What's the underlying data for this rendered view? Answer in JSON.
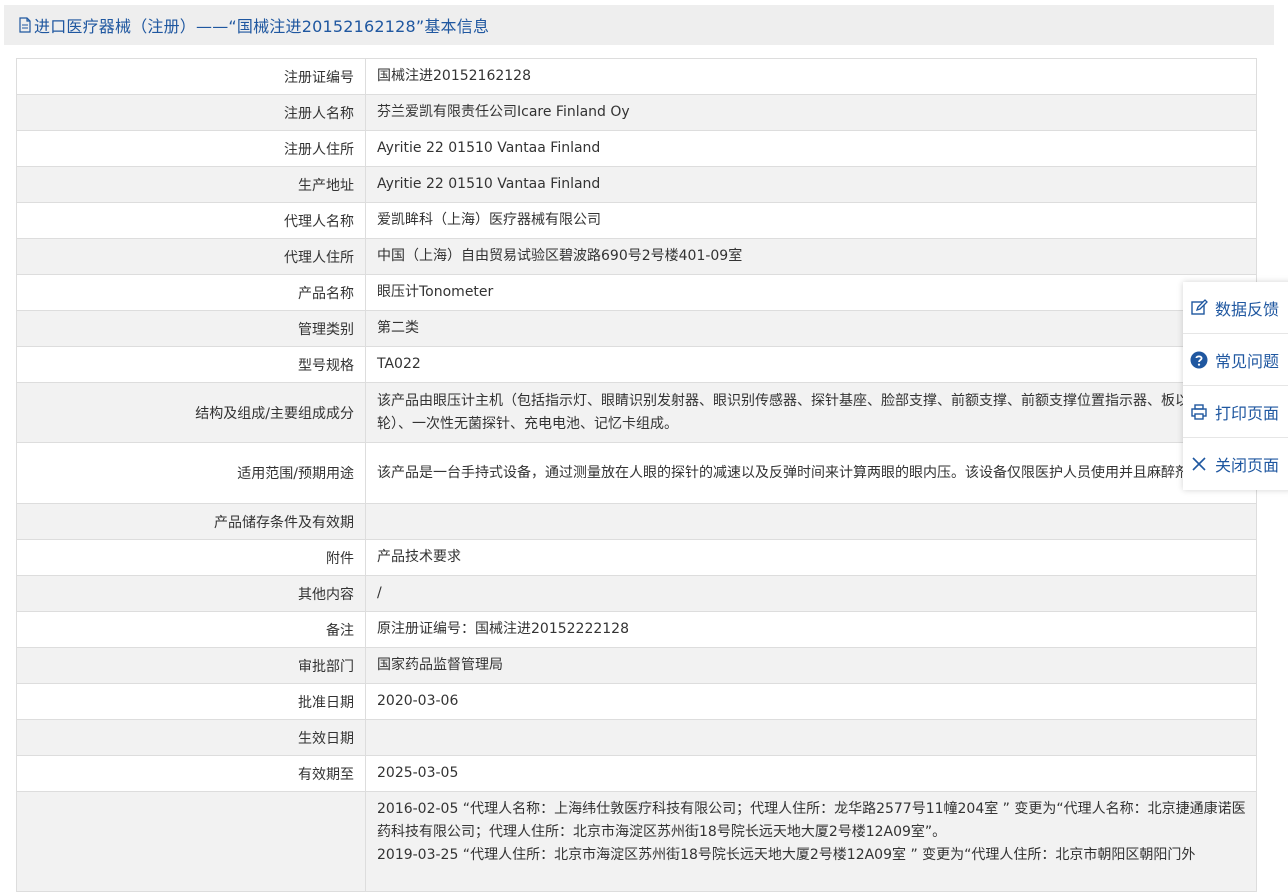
{
  "header": {
    "title": "进口医疗器械（注册）——“国械注进20152162128”基本信息"
  },
  "fields": [
    {
      "key": "注册证编号",
      "value": "国械注进20152162128"
    },
    {
      "key": "注册人名称",
      "value": "芬兰爱凯有限责任公司Icare Finland Oy"
    },
    {
      "key": "注册人住所",
      "value": "Ayritie 22 01510 Vantaa Finland"
    },
    {
      "key": "生产地址",
      "value": "Ayritie 22 01510 Vantaa Finland"
    },
    {
      "key": "代理人名称",
      "value": "爱凯眸科（上海）医疗器械有限公司"
    },
    {
      "key": "代理人住所",
      "value": "中国（上海）自由贸易试验区碧波路690号2号楼401-09室"
    },
    {
      "key": "产品名称",
      "value": "眼压计Tonometer"
    },
    {
      "key": "管理类别",
      "value": "第二类"
    },
    {
      "key": "型号规格",
      "value": "TA022"
    },
    {
      "key": "结构及组成/主要组成成分",
      "value": "该产品由眼压计主机（包括指示灯、眼睛识别发射器、眼识别传感器、探针基座、脸部支撑、前额支撑、前额支撑位置指示器、板以及调整轮）、一次性无菌探针、充电电池、记忆卡组成。"
    },
    {
      "key": "适用范围/预期用途",
      "value": "该产品是一台手持式设备，通过测量放在人眼的探针的减速以及反弹时间来计算两眼的眼内压。该设备仅限医护人员使用并且麻醉剂。"
    },
    {
      "key": "产品储存条件及有效期",
      "value": ""
    },
    {
      "key": "附件",
      "value": "产品技术要求"
    },
    {
      "key": "其他内容",
      "value": "/"
    },
    {
      "key": "备注",
      "value": "原注册证编号：国械注进20152222128"
    },
    {
      "key": "审批部门",
      "value": "国家药品监督管理局"
    },
    {
      "key": "批准日期",
      "value": "2020-03-06"
    },
    {
      "key": "生效日期",
      "value": ""
    },
    {
      "key": "有效期至",
      "value": "2025-03-05"
    }
  ],
  "change_history": {
    "key": "",
    "entries": [
      "2016-02-05 “代理人名称：上海纬仕敦医疗科技有限公司；代理人住所：龙华路2577号11幢204室 ” 变更为“代理人名称：北京捷通康诺医药科技有限公司；代理人住所：北京市海淀区苏州街18号院长远天地大厦2号楼12A09室”。",
      "2019-03-25 “代理人住所：北京市海淀区苏州街18号院长远天地大厦2号楼12A09室 ” 变更为“代理人住所：北京市朝阳区朝阳门外"
    ]
  },
  "side_panel": {
    "items": [
      {
        "label": "数据反馈",
        "icon": "edit-icon"
      },
      {
        "label": "常见问题",
        "icon": "question-circle-icon"
      },
      {
        "label": "打印页面",
        "icon": "printer-icon"
      },
      {
        "label": "关闭页面",
        "icon": "close-icon"
      }
    ]
  },
  "colors": {
    "accent": "#1f57a0",
    "header_bg": "#eeeeee",
    "row_alt_bg": "#f2f2f2",
    "border": "#dddddd"
  }
}
